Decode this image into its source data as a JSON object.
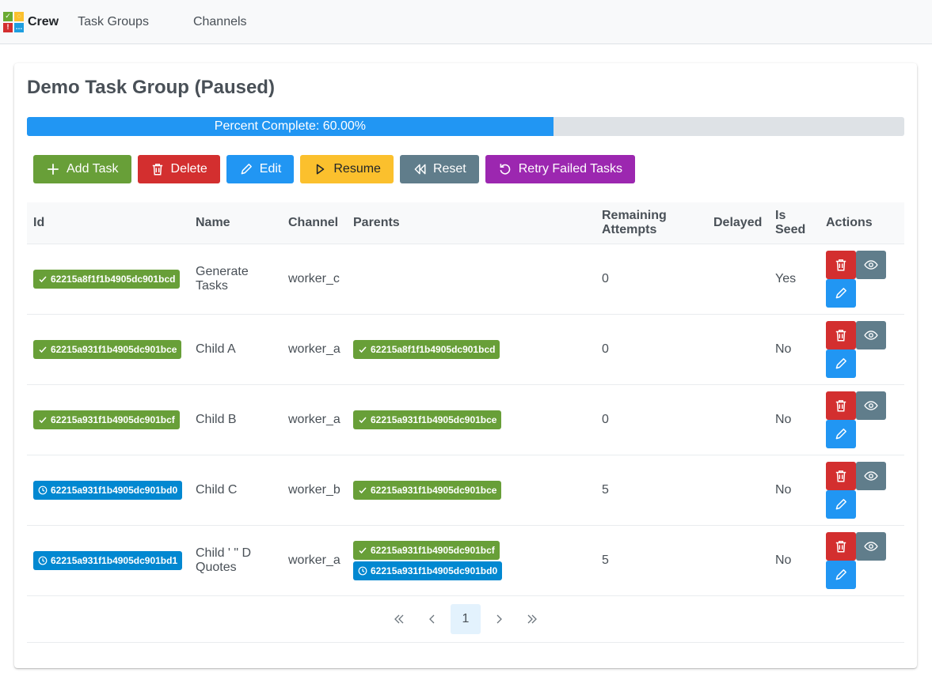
{
  "nav": {
    "brand": "Crew",
    "links": [
      "Task Groups",
      "Channels"
    ]
  },
  "group": {
    "title": "Demo Task Group (Paused)",
    "progress_label": "Percent Complete: 60.00%",
    "progress_fraction": 0.6
  },
  "toolbar": {
    "add_task": "Add Task",
    "delete": "Delete",
    "edit": "Edit",
    "resume": "Resume",
    "reset": "Reset",
    "retry": "Retry Failed Tasks"
  },
  "table": {
    "headers": [
      "Id",
      "Name",
      "Channel",
      "Parents",
      "Remaining Attempts",
      "Delayed",
      "Is Seed",
      "Actions"
    ],
    "rows": [
      {
        "id": "62215a8f1f1b4905dc901bcd",
        "id_status": "complete",
        "name": "Generate Tasks",
        "channel": "worker_c",
        "parents": [],
        "remaining": "0",
        "delayed": "",
        "is_seed": "Yes"
      },
      {
        "id": "62215a931f1b4905dc901bce",
        "id_status": "complete",
        "name": "Child A",
        "channel": "worker_a",
        "parents": [
          {
            "id": "62215a8f1f1b4905dc901bcd",
            "status": "complete"
          }
        ],
        "remaining": "0",
        "delayed": "",
        "is_seed": "No"
      },
      {
        "id": "62215a931f1b4905dc901bcf",
        "id_status": "complete",
        "name": "Child B",
        "channel": "worker_a",
        "parents": [
          {
            "id": "62215a931f1b4905dc901bce",
            "status": "complete"
          }
        ],
        "remaining": "0",
        "delayed": "",
        "is_seed": "No"
      },
      {
        "id": "62215a931f1b4905dc901bd0",
        "id_status": "pending",
        "name": "Child C",
        "channel": "worker_b",
        "parents": [
          {
            "id": "62215a931f1b4905dc901bce",
            "status": "complete"
          }
        ],
        "remaining": "5",
        "delayed": "",
        "is_seed": "No"
      },
      {
        "id": "62215a931f1b4905dc901bd1",
        "id_status": "pending",
        "name": "Child ' \" D Quotes",
        "channel": "worker_a",
        "parents": [
          {
            "id": "62215a931f1b4905dc901bcf",
            "status": "complete"
          },
          {
            "id": "62215a931f1b4905dc901bd0",
            "status": "pending"
          }
        ],
        "remaining": "5",
        "delayed": "",
        "is_seed": "No"
      }
    ]
  },
  "pager": {
    "current_page": "1"
  },
  "colors": {
    "complete": "#689f38",
    "pending": "#0288d1",
    "progress": "#2196f3"
  },
  "icons": {
    "complete": "check-icon",
    "pending": "clock-icon"
  }
}
